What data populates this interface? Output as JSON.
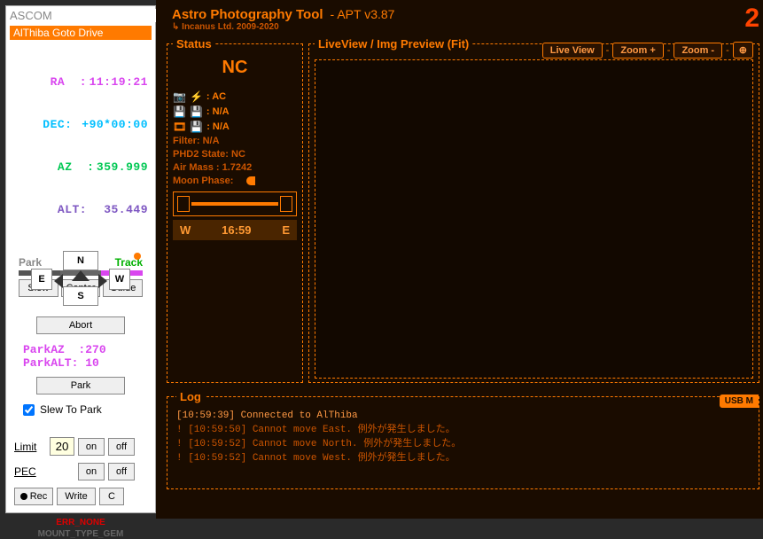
{
  "sidebar": {
    "ascom_title": "ASCOM",
    "driver_name": "AlThiba Goto Drive",
    "coords": {
      "ra_label": "RA  :",
      "ra": "11:19:21",
      "dec_label": "DEC:",
      "dec": "+90*00:00",
      "az_label": "AZ  :",
      "az": "359.999",
      "alt_label": "ALT:",
      "alt": " 35.449"
    },
    "dpad": {
      "n": "N",
      "s": "S",
      "e": "E",
      "w": "W"
    },
    "modes": {
      "park": "Park",
      "slew": "Slew",
      "track": "Track"
    },
    "actions": {
      "slew": "Slew",
      "center": "Center",
      "guide": "Guide",
      "abort": "Abort"
    },
    "parkpos": {
      "az_label": "ParkAZ  :",
      "az": "270",
      "alt_label": "ParkALT:",
      "alt": " 10"
    },
    "park_btn": "Park",
    "slew_to_park": "Slew To Park",
    "limit_label": "Limit",
    "limit_value": "20",
    "pec_label": "PEC",
    "on": "on",
    "off": "off",
    "rec": "Rec",
    "write": "Write",
    "c": "C",
    "err": "ERR_NONE",
    "mount_type": "MOUNT_TYPE_GEM"
  },
  "main": {
    "title1": "Astro Photography Tool",
    "title2": "-  APT v3.87",
    "sub": "Incanus Ltd. 2009-2020",
    "big": "2",
    "status": {
      "legend": "Status",
      "nc": "NC",
      "ac_label": ": AC",
      "na1": ": N/A",
      "na2": ": N/A",
      "filter": "Filter: N/A",
      "phd2": "PHD2 State: NC",
      "airmass": "Air Mass : 1.7242",
      "moon": "Moon Phase:",
      "w": "W",
      "time": "16:59",
      "e": "E"
    },
    "preview": {
      "legend": "LiveView / Img Preview (Fit)",
      "live": "Live View",
      "zoomin": "Zoom +",
      "zoomout": "Zoom -",
      "target": "⊕"
    },
    "log": {
      "legend": "Log",
      "usb": "USB M",
      "lines": [
        {
          "cls": "ok",
          "text": "  [10:59:39] Connected to AlThiba"
        },
        {
          "cls": "warn",
          "text": "! [10:59:50] Cannot move East.   例外が発生しました。"
        },
        {
          "cls": "warn",
          "text": "! [10:59:52] Cannot move North.  例外が発生しました。"
        },
        {
          "cls": "warn",
          "text": "! [10:59:52] Cannot move West.   例外が発生しました。"
        }
      ]
    }
  }
}
